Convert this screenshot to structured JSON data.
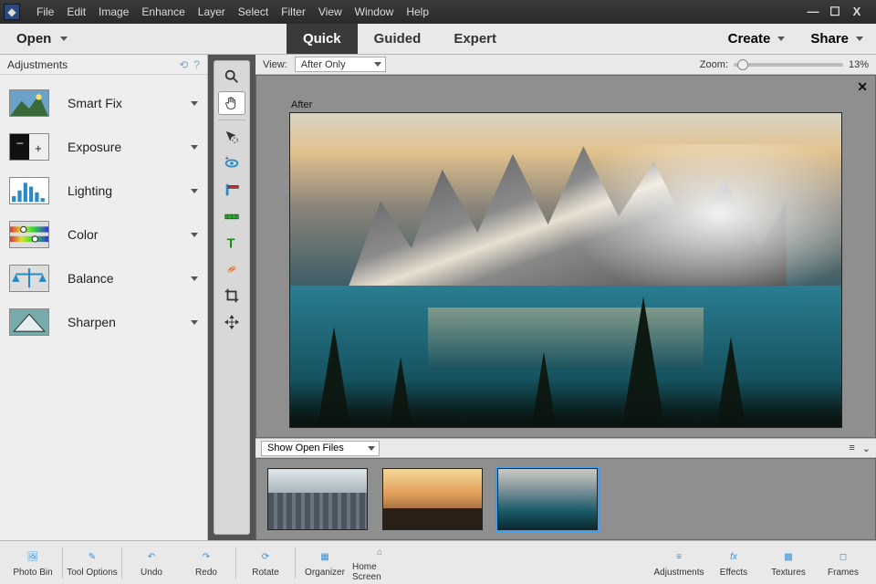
{
  "menubar": {
    "items": [
      "File",
      "Edit",
      "Image",
      "Enhance",
      "Layer",
      "Select",
      "Filter",
      "View",
      "Window",
      "Help"
    ]
  },
  "window_controls": {
    "min": "—",
    "max": "☐",
    "close": "X"
  },
  "actionbar": {
    "open_label": "Open",
    "tabs": [
      {
        "label": "Quick",
        "active": true
      },
      {
        "label": "Guided",
        "active": false
      },
      {
        "label": "Expert",
        "active": false
      }
    ],
    "create_label": "Create",
    "share_label": "Share"
  },
  "adjustments": {
    "header": "Adjustments",
    "items": [
      {
        "label": "Smart Fix",
        "icon": "smart-fix"
      },
      {
        "label": "Exposure",
        "icon": "exposure"
      },
      {
        "label": "Lighting",
        "icon": "lighting"
      },
      {
        "label": "Color",
        "icon": "color"
      },
      {
        "label": "Balance",
        "icon": "balance"
      },
      {
        "label": "Sharpen",
        "icon": "sharpen"
      }
    ]
  },
  "tools": [
    {
      "name": "zoom",
      "selected": false
    },
    {
      "name": "hand",
      "selected": true
    },
    {
      "name": "quick-select",
      "selected": false,
      "sep_before": true
    },
    {
      "name": "eye",
      "selected": false
    },
    {
      "name": "whiten",
      "selected": false
    },
    {
      "name": "straighten",
      "selected": false
    },
    {
      "name": "text",
      "selected": false
    },
    {
      "name": "heal",
      "selected": false
    },
    {
      "name": "crop",
      "selected": false
    },
    {
      "name": "move",
      "selected": false
    }
  ],
  "viewbar": {
    "view_label": "View:",
    "view_value": "After Only",
    "zoom_label": "Zoom:",
    "zoom_value": "13%"
  },
  "canvas": {
    "after_label": "After"
  },
  "bin": {
    "selector_value": "Show Open Files",
    "thumbs": [
      {
        "name": "city",
        "selected": false
      },
      {
        "name": "beach",
        "selected": false
      },
      {
        "name": "lakemt",
        "selected": true
      }
    ]
  },
  "taskbar": {
    "left": [
      {
        "label": "Photo Bin",
        "icon": "photo-bin"
      },
      {
        "label": "Tool Options",
        "icon": "tool-options"
      },
      {
        "label": "Undo",
        "icon": "undo"
      },
      {
        "label": "Redo",
        "icon": "redo"
      },
      {
        "label": "Rotate",
        "icon": "rotate"
      },
      {
        "label": "Organizer",
        "icon": "organizer"
      },
      {
        "label": "Home Screen",
        "icon": "home"
      }
    ],
    "right": [
      {
        "label": "Adjustments",
        "icon": "sliders"
      },
      {
        "label": "Effects",
        "icon": "fx"
      },
      {
        "label": "Textures",
        "icon": "textures"
      },
      {
        "label": "Frames",
        "icon": "frames"
      }
    ]
  },
  "colors": {
    "accent_blue": "#3a8fd4"
  }
}
